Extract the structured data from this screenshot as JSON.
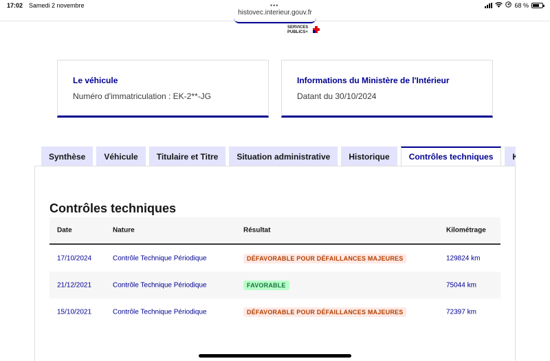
{
  "status_bar": {
    "time": "17:02",
    "date": "Samedi 2 novembre",
    "battery": "68 %",
    "battery_level": 0.68
  },
  "browser": {
    "dots": "•••",
    "url": "histovec.interieur.gouv.fr"
  },
  "logo": {
    "line1": "SERVICES",
    "line2": "PUBLICS+"
  },
  "cards": {
    "vehicle": {
      "title": "Le véhicule",
      "text": "Numéro d'immatriculation : EK-2**-JG"
    },
    "ministry": {
      "title": "Informations du Ministère de l'Intérieur",
      "text": "Datant du 30/10/2024"
    }
  },
  "tabs": [
    {
      "label": "Synthèse"
    },
    {
      "label": "Véhicule"
    },
    {
      "label": "Titulaire et Titre"
    },
    {
      "label": "Situation administrative"
    },
    {
      "label": "Historique"
    },
    {
      "label": "Contrôles techniques"
    },
    {
      "label": "Kilométrage"
    }
  ],
  "active_tab": 5,
  "section": {
    "title": "Contrôles techniques"
  },
  "table": {
    "headers": {
      "date": "Date",
      "nature": "Nature",
      "result": "Résultat",
      "mileage": "Kilométrage"
    },
    "rows": [
      {
        "date": "17/10/2024",
        "nature": "Contrôle Technique Périodique",
        "result": "DÉFAVORABLE POUR DÉFAILLANCES MAJEURES",
        "mileage": "129824 km"
      },
      {
        "date": "21/12/2021",
        "nature": "Contrôle Technique Périodique",
        "result": "FAVORABLE",
        "mileage": "75044 km"
      },
      {
        "date": "15/10/2021",
        "nature": "Contrôle Technique Périodique",
        "result": "DÉFAVORABLE POUR DÉFAILLANCES MAJEURES",
        "mileage": "72397 km"
      }
    ]
  },
  "colors": {
    "primary": "#000091",
    "tab_bg": "#e3e3fd",
    "bad_bg": "#fee9e5",
    "bad_text": "#b34000",
    "good_bg": "#b8fec9",
    "good_text": "#18753c"
  }
}
